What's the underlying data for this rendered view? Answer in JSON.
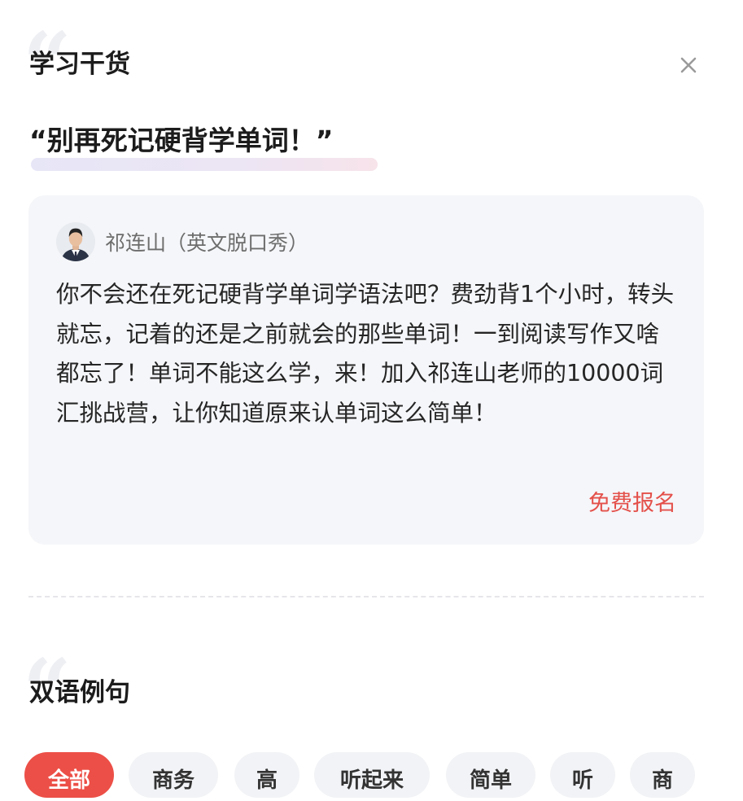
{
  "sections": {
    "study": {
      "title": "学习干货",
      "headline": "“别再死记硬背学单词！”"
    },
    "bilingual": {
      "title": "双语例句"
    }
  },
  "card": {
    "author": "祁连山（英文脱口秀）",
    "body": "你不会还在死记硬背学单词学语法吧？费劲背1个小时，转头就忘，记着的还是之前就会的那些单词！一到阅读写作又啥都忘了！单词不能这么学，来！加入祁连山老师的10000词汇挑战营，让你知道原来认单词这么简单！",
    "action_label": "免费报名"
  },
  "icons": {
    "close": "close-icon",
    "quote": "quote-mark-icon",
    "avatar": "avatar-portrait"
  },
  "tabs": [
    {
      "label": "全部",
      "active": true
    },
    {
      "label": "商务",
      "active": false
    },
    {
      "label": "高",
      "active": false
    },
    {
      "label": "听起来",
      "active": false
    },
    {
      "label": "简单",
      "active": false
    },
    {
      "label": "听",
      "active": false
    },
    {
      "label": "商",
      "active": false
    }
  ],
  "colors": {
    "accent": "#ec4f47",
    "link": "#e4504a",
    "card_bg": "#f5f6f9",
    "tab_bg": "#f2f3f6"
  }
}
